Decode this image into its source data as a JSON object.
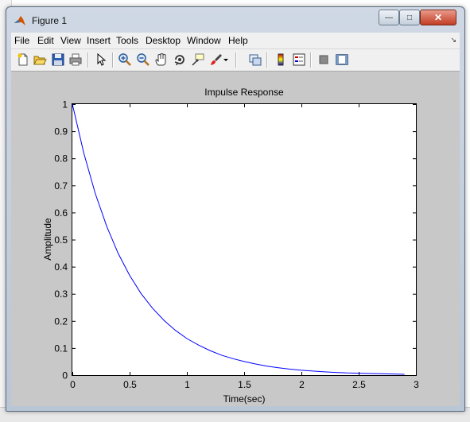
{
  "window": {
    "title": "Figure 1",
    "minimize_glyph": "—",
    "maximize_glyph": "□",
    "close_glyph": "✕"
  },
  "menubar": {
    "items": [
      "File",
      "Edit",
      "View",
      "Insert",
      "Tools",
      "Desktop",
      "Window",
      "Help"
    ]
  },
  "toolbar": {
    "icons": [
      "new-figure-icon",
      "open-file-icon",
      "save-icon",
      "print-icon",
      "edit-plot-arrow-icon",
      "zoom-in-icon",
      "zoom-out-icon",
      "pan-hand-icon",
      "rotate-3d-icon",
      "data-cursor-icon",
      "brush-icon",
      "brush-dropdown-icon",
      "link-plot-icon",
      "colorbar-icon",
      "legend-icon",
      "hide-plot-tools-icon",
      "show-plot-tools-icon"
    ]
  },
  "colors": {
    "curve": "#0000ff",
    "figure_bg": "#c8c8c8",
    "axes_bg": "#ffffff"
  },
  "chart_data": {
    "type": "line",
    "title": "Impulse Response",
    "xlabel": "Time(sec)",
    "ylabel": "Amplitude",
    "xlim": [
      0,
      3
    ],
    "ylim": [
      0,
      1
    ],
    "xticks": [
      "0",
      "0.5",
      "1",
      "1.5",
      "2",
      "2.5",
      "3"
    ],
    "yticks": [
      "0",
      "0.1",
      "0.2",
      "0.3",
      "0.4",
      "0.5",
      "0.6",
      "0.7",
      "0.8",
      "0.9",
      "1"
    ],
    "grid": false,
    "series": [
      {
        "color": "#0000ff",
        "x": [
          0,
          0.1,
          0.2,
          0.3,
          0.4,
          0.5,
          0.6,
          0.7,
          0.8,
          0.9,
          1.0,
          1.1,
          1.2,
          1.3,
          1.4,
          1.5,
          1.6,
          1.7,
          1.8,
          1.9,
          2.0,
          2.1,
          2.2,
          2.3,
          2.4,
          2.5,
          2.6,
          2.7,
          2.8,
          2.9
        ],
        "y": [
          1.0,
          0.819,
          0.67,
          0.549,
          0.449,
          0.368,
          0.301,
          0.247,
          0.202,
          0.165,
          0.135,
          0.111,
          0.091,
          0.074,
          0.061,
          0.05,
          0.041,
          0.033,
          0.027,
          0.022,
          0.018,
          0.015,
          0.012,
          0.01,
          0.008,
          0.007,
          0.006,
          0.005,
          0.004,
          0.003
        ]
      }
    ]
  }
}
